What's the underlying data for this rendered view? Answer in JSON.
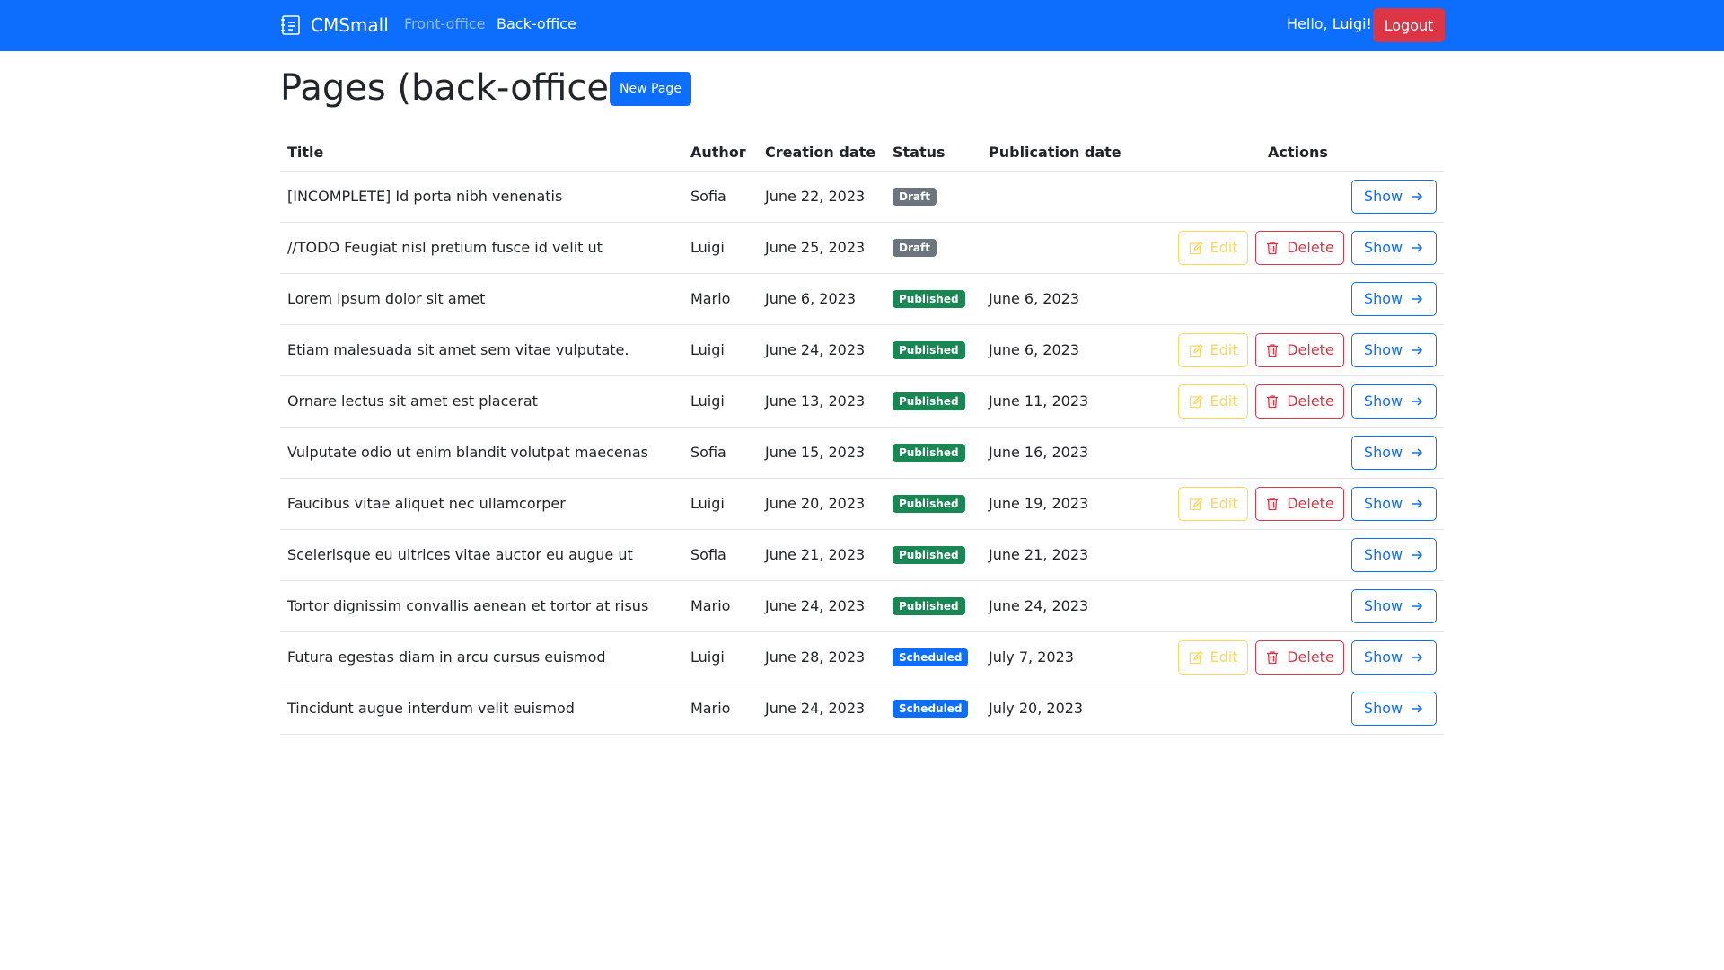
{
  "navbar": {
    "brand": "CMSmall",
    "links": [
      "Front-office",
      "Back-office"
    ],
    "greeting": "Hello, Luigi!",
    "logout_label": "Logout"
  },
  "main": {
    "title": "Pages (back-office)",
    "new_page_label": "New Page"
  },
  "table": {
    "headers": [
      "Title",
      "Author",
      "Creation date",
      "Status",
      "Publication date",
      "Actions"
    ],
    "action_labels": {
      "edit": "Edit",
      "delete": "Delete",
      "show": "Show"
    },
    "rows": [
      {
        "title": "[INCOMPLETE] Id porta nibh venenatis",
        "author": "Sofia",
        "creation_date": "June 22, 2023",
        "status": "Draft",
        "publication_date": "",
        "editable": false
      },
      {
        "title": "//TODO Feugiat nisl pretium fusce id velit ut",
        "author": "Luigi",
        "creation_date": "June 25, 2023",
        "status": "Draft",
        "publication_date": "",
        "editable": true
      },
      {
        "title": "Lorem ipsum dolor sit amet",
        "author": "Mario",
        "creation_date": "June 6, 2023",
        "status": "Published",
        "publication_date": "June 6, 2023",
        "editable": false
      },
      {
        "title": "Etiam malesuada sit amet sem vitae vulputate.",
        "author": "Luigi",
        "creation_date": "June 24, 2023",
        "status": "Published",
        "publication_date": "June 6, 2023",
        "editable": true
      },
      {
        "title": "Ornare lectus sit amet est placerat",
        "author": "Luigi",
        "creation_date": "June 13, 2023",
        "status": "Published",
        "publication_date": "June 11, 2023",
        "editable": true
      },
      {
        "title": "Vulputate odio ut enim blandit volutpat maecenas",
        "author": "Sofia",
        "creation_date": "June 15, 2023",
        "status": "Published",
        "publication_date": "June 16, 2023",
        "editable": false
      },
      {
        "title": "Faucibus vitae aliquet nec ullamcorper",
        "author": "Luigi",
        "creation_date": "June 20, 2023",
        "status": "Published",
        "publication_date": "June 19, 2023",
        "editable": true
      },
      {
        "title": "Scelerisque eu ultrices vitae auctor eu augue ut",
        "author": "Sofia",
        "creation_date": "June 21, 2023",
        "status": "Published",
        "publication_date": "June 21, 2023",
        "editable": false
      },
      {
        "title": "Tortor dignissim convallis aenean et tortor at risus",
        "author": "Mario",
        "creation_date": "June 24, 2023",
        "status": "Published",
        "publication_date": "June 24, 2023",
        "editable": false
      },
      {
        "title": "Futura egestas diam in arcu cursus euismod",
        "author": "Luigi",
        "creation_date": "June 28, 2023",
        "status": "Scheduled",
        "publication_date": "July 7, 2023",
        "editable": true
      },
      {
        "title": "Tincidunt augue interdum velit euismod",
        "author": "Mario",
        "creation_date": "June 24, 2023",
        "status": "Scheduled",
        "publication_date": "July 20, 2023",
        "editable": false
      }
    ]
  },
  "icons": {
    "brand": "journal-text-icon",
    "edit": "pencil-square-icon",
    "delete": "trash-icon",
    "show": "arrow-right-icon"
  },
  "colors": {
    "navbar": "#0d6efd",
    "logout": "#dc3545",
    "draft": "#6c757d",
    "published": "#198754",
    "scheduled": "#0d6efd",
    "edit": "#ffc107"
  }
}
